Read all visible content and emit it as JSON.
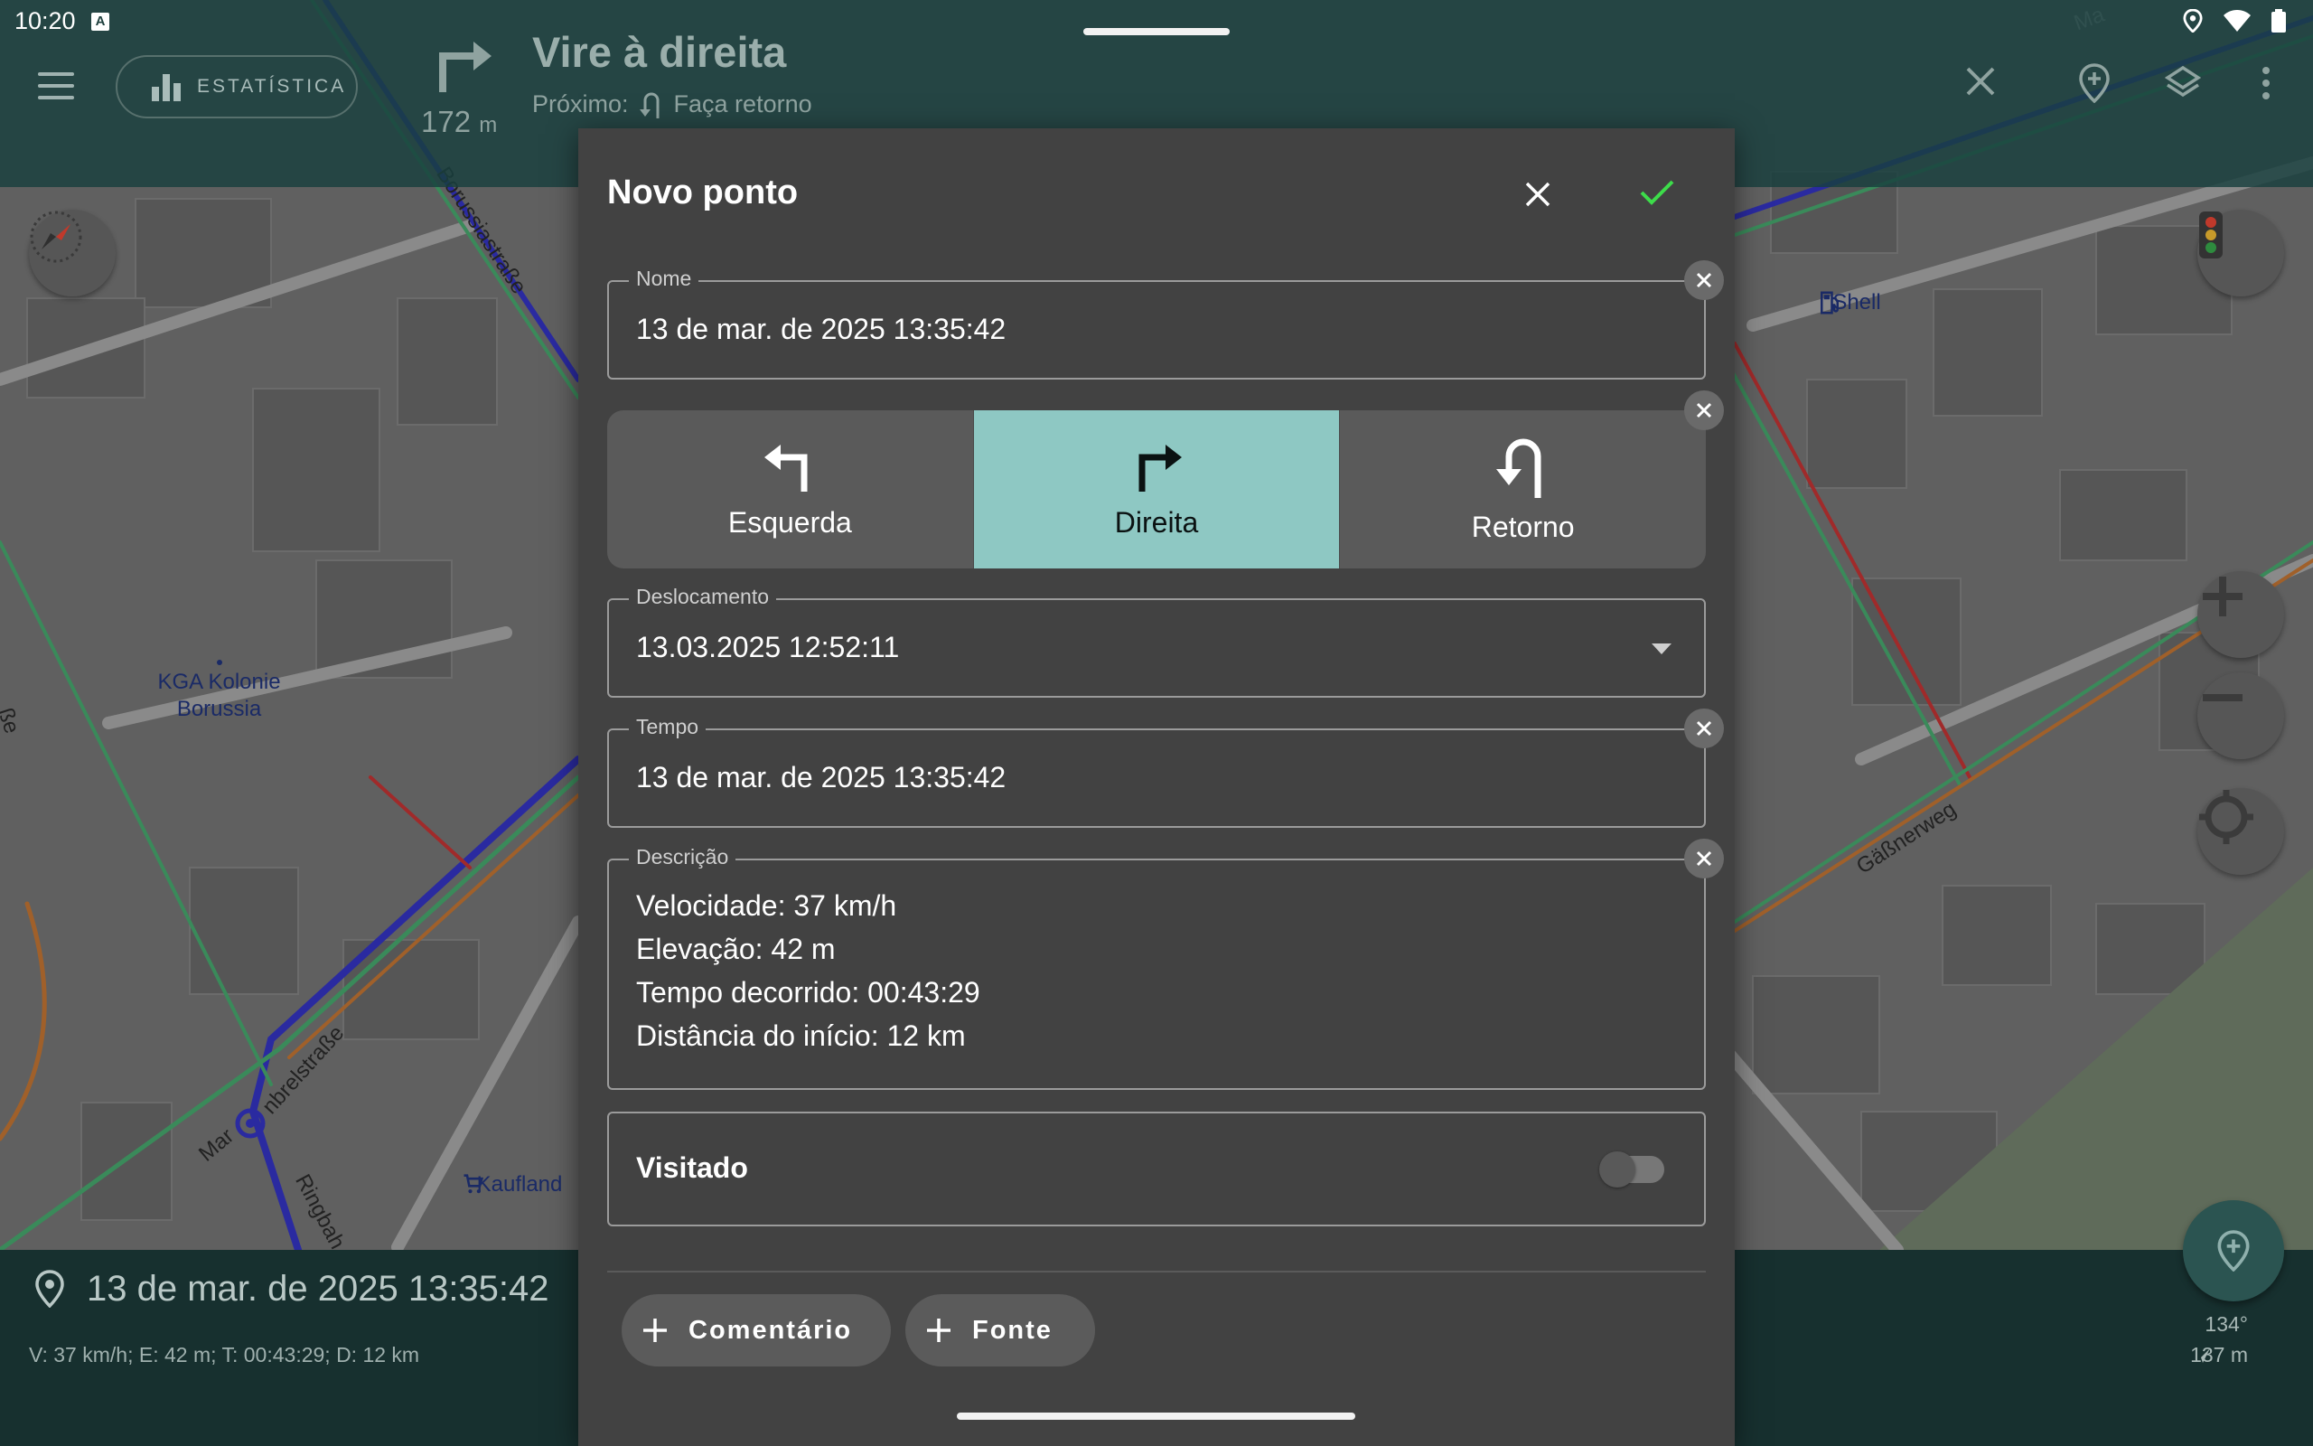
{
  "status_bar": {
    "time": "10:20",
    "badge": "A"
  },
  "nav": {
    "stats_label": "ESTATÍSTICA",
    "distance_value": "172",
    "distance_unit": "m",
    "instruction": "Vire à direita",
    "next_prefix": "Próximo:",
    "next_instruction": "Faça retorno"
  },
  "map": {
    "labels": {
      "kga": "KGA Kolonie\nBorussia",
      "shell": "Shell",
      "kaufland": "Kaufland",
      "borussia_street": "Borussiastraße",
      "gassnerweg": "Gäßnerweg",
      "ringbahn": "Ringbah",
      "marten": "Mar",
      "marten2": "nbrelstraße",
      "partial_left": "ße",
      "partial_top": "Ma"
    }
  },
  "bottom_bar": {
    "title": "13 de mar. de 2025 13:35:42",
    "stats": "V: 37 km/h; E: 42 m; T: 00:43:29; D: 12 km",
    "heading": "134°",
    "distance": "137 m"
  },
  "dialog": {
    "title": "Novo ponto",
    "name": {
      "label": "Nome",
      "value": "13 de mar. de 2025 13:35:42"
    },
    "direction": {
      "options": [
        {
          "label": "Esquerda",
          "icon": "turn-left-icon"
        },
        {
          "label": "Direita",
          "icon": "turn-right-icon",
          "selected": true
        },
        {
          "label": "Retorno",
          "icon": "u-turn-icon"
        }
      ]
    },
    "offset": {
      "label": "Deslocamento",
      "value": "13.03.2025 12:52:11"
    },
    "time": {
      "label": "Tempo",
      "value": "13 de mar. de 2025 13:35:42"
    },
    "description": {
      "label": "Descrição",
      "lines": [
        "Velocidade: 37 km/h",
        "Elevação: 42 m",
        "Tempo decorrido: 00:43:29",
        "Distância do início: 12 km"
      ]
    },
    "visited": {
      "label": "Visitado",
      "checked": false
    },
    "chips": {
      "comment": "Comentário",
      "source": "Fonte"
    }
  },
  "colors": {
    "accent_selected": "#8ec8c3",
    "confirm_check": "#3ddc4a",
    "dialog_bg": "#424242",
    "topbar_bg": "#18403e",
    "bottombar_bg": "#17302f"
  }
}
